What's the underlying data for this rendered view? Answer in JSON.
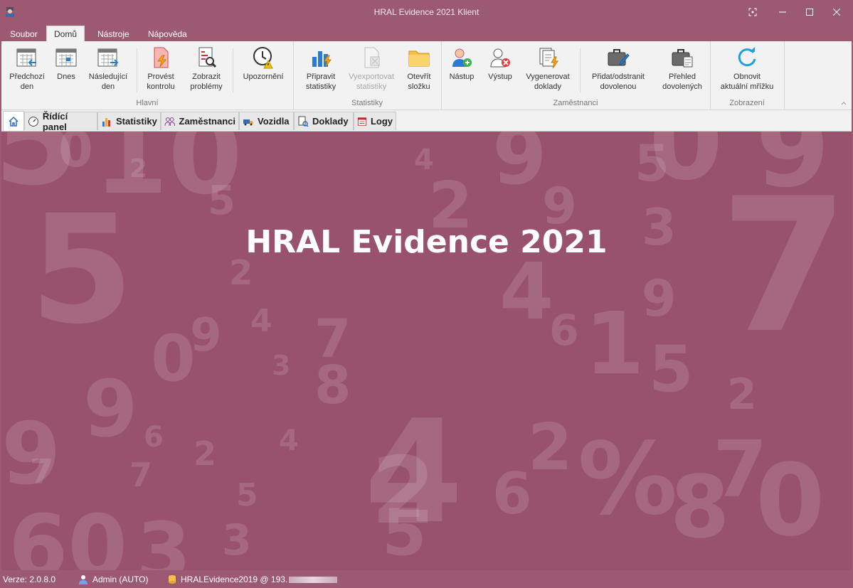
{
  "window": {
    "title": "HRAL Evidence 2021 Klient"
  },
  "menu": {
    "tabs": [
      "Soubor",
      "Domů",
      "Nástroje",
      "Nápověda"
    ],
    "active": "Domů"
  },
  "ribbon": {
    "groups": {
      "hlavni": "Hlavní",
      "statistiky": "Statistiky",
      "zamestnanci": "Zaměstnanci",
      "zobrazeni": "Zobrazení"
    },
    "buttons": {
      "predchozi": [
        "Předchozí",
        "den"
      ],
      "dnes": [
        "Dnes"
      ],
      "nasledujici": [
        "Následující",
        "den"
      ],
      "provest": [
        "Provést",
        "kontrolu"
      ],
      "zobrazit": [
        "Zobrazit",
        "problémy"
      ],
      "upozorneni": [
        "Upozornění"
      ],
      "pripravit": [
        "Připravit",
        "statistiky"
      ],
      "vyexportovat": [
        "Vyexportovat",
        "statistiky"
      ],
      "otevrit": [
        "Otevřít",
        "složku"
      ],
      "nastup": [
        "Nástup"
      ],
      "vystup": [
        "Výstup"
      ],
      "vygenerovat": [
        "Vygenerovat",
        "doklady"
      ],
      "pridat": [
        "Přidat/odstranit",
        "dovolenou"
      ],
      "prehled": [
        "Přehled",
        "dovolených"
      ],
      "obnovit": [
        "Obnovit",
        "aktuální mřížku"
      ]
    }
  },
  "doc_tabs": [
    "Řídící panel",
    "Statistiky",
    "Zaměstnanci",
    "Vozidla",
    "Doklady",
    "Logy"
  ],
  "content": {
    "hero_title": "HRAL Evidence 2021"
  },
  "status": {
    "version": "Verze: 2.0.8.0",
    "user": "Admin (AUTO)",
    "db": "HRALEvidence2019 @ 193."
  },
  "colors": {
    "accent": "#9c5a72",
    "content_bg": "#99526d",
    "ribbon_bg": "#f2f2f2"
  }
}
